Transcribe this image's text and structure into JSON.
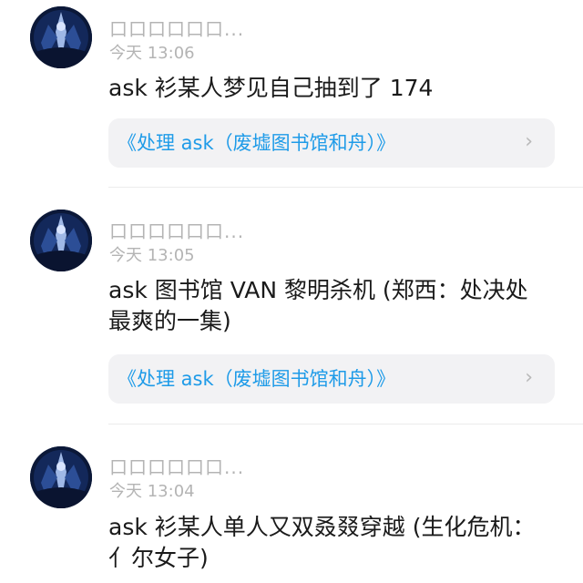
{
  "posts": [
    {
      "username": "口口口口口口...",
      "time": "今天 13:06",
      "content": "ask 衫某人梦见自己抽到了 174",
      "card": {
        "label": "《处理 ask（废墟图书馆和舟）》",
        "chevron": "›"
      }
    },
    {
      "username": "口口口口口口...",
      "time": "今天 13:05",
      "content": "ask 图书馆 VAN 黎明杀机 (郑西：处决处最爽的一集)",
      "card": {
        "label": "《处理 ask（废墟图书馆和舟）》",
        "chevron": "›"
      }
    },
    {
      "username": "口口口口口口...",
      "time": "今天 13:04",
      "content": "ask 衫某人单人又双叒叕穿越 (生化危机：亻尔女子)"
    }
  ],
  "colors": {
    "link": "#1e9be8",
    "meta": "#b4b4b4",
    "card_bg": "#f2f2f4",
    "avatar_bg": "#0c1a3a"
  }
}
